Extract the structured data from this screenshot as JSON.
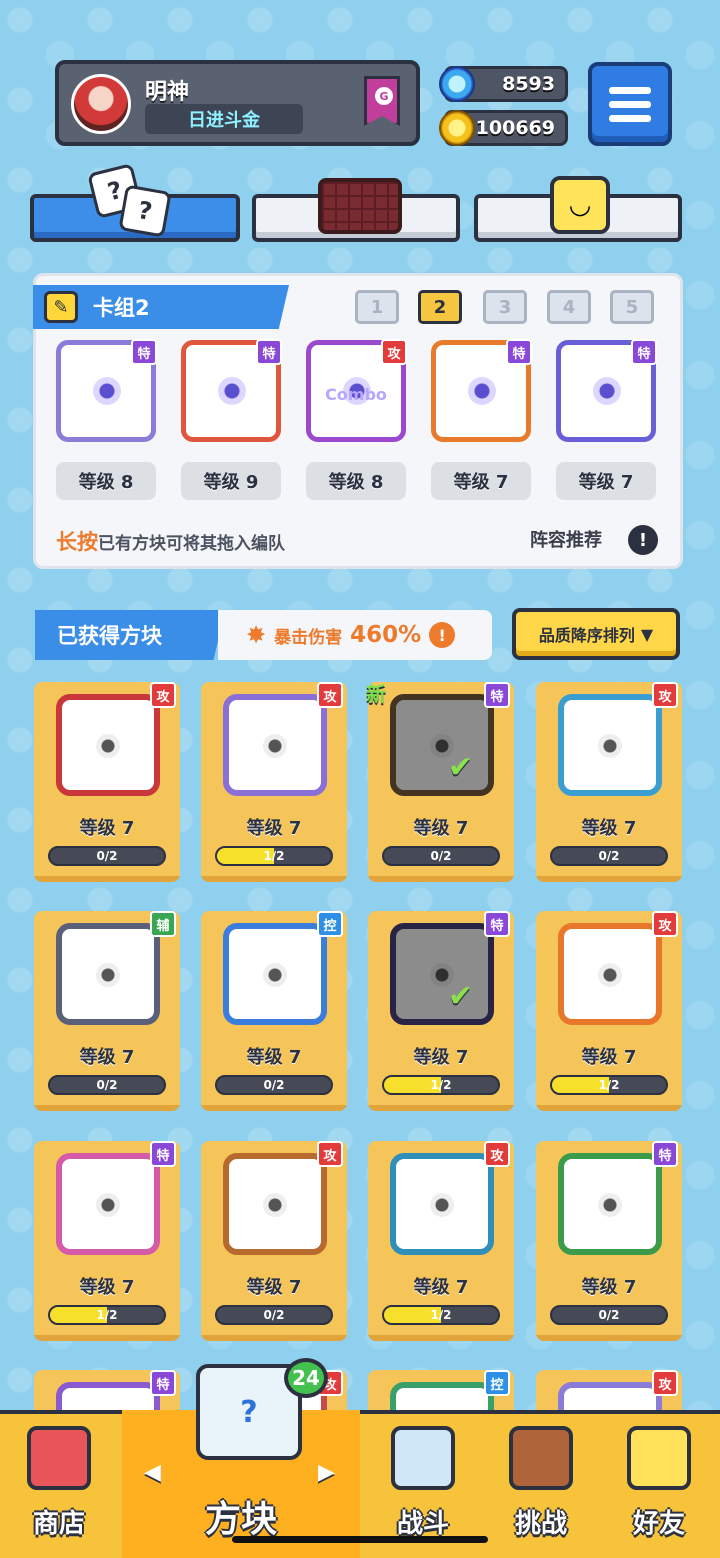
{
  "profile": {
    "name": "明神",
    "subtitle": "日进斗金",
    "rank_letter": "G"
  },
  "currency": {
    "gems": "8593",
    "coins": "100669"
  },
  "deck": {
    "title": "卡组2",
    "numbers": [
      "1",
      "2",
      "3",
      "4",
      "5"
    ],
    "selected_index": 1,
    "cards": [
      {
        "tag": "特",
        "level": "等级 8",
        "color": "#8a7cd8"
      },
      {
        "tag": "特",
        "level": "等级 9",
        "color": "#e0563c"
      },
      {
        "tag": "攻",
        "level": "等级 8",
        "color": "#9b4ad0",
        "label": "Combo"
      },
      {
        "tag": "特",
        "level": "等级 7",
        "color": "#e97a2b"
      },
      {
        "tag": "特",
        "level": "等级 7",
        "color": "#6a5fd8"
      }
    ],
    "hint_strong": "长按",
    "hint_rest": "已有方块可将其拖入编队",
    "recommend": "阵容推荐"
  },
  "owned": {
    "title": "已获得方块",
    "crit_label": "暴击伤害",
    "crit_value": "460%",
    "sort_label": "品质降序排列",
    "new_label": "新",
    "cards": [
      {
        "tag": "攻",
        "level": "等级 7",
        "progress": "0/2",
        "fill": 0,
        "color": "#c9373a"
      },
      {
        "tag": "攻",
        "level": "等级 7",
        "progress": "1/2",
        "fill": 0.5,
        "color": "#8a6fd6"
      },
      {
        "tag": "特",
        "level": "等级 7",
        "progress": "0/2",
        "fill": 0,
        "color": "#7a5c3a",
        "checked": true
      },
      {
        "tag": "攻",
        "level": "等级 7",
        "progress": "0/2",
        "fill": 0,
        "color": "#3a9ed0"
      },
      {
        "tag": "辅",
        "level": "等级 7",
        "progress": "0/2",
        "fill": 0,
        "color": "#5a5f7a"
      },
      {
        "tag": "控",
        "level": "等级 7",
        "progress": "0/2",
        "fill": 0,
        "color": "#3b7ddc"
      },
      {
        "tag": "特",
        "level": "等级 7",
        "progress": "1/2",
        "fill": 0.5,
        "color": "#4a3f80",
        "checked": true
      },
      {
        "tag": "攻",
        "level": "等级 7",
        "progress": "1/2",
        "fill": 0.5,
        "color": "#e9772b"
      },
      {
        "tag": "特",
        "level": "等级 7",
        "progress": "1/2",
        "fill": 0.5,
        "color": "#d55aa8"
      },
      {
        "tag": "攻",
        "level": "等级 7",
        "progress": "0/2",
        "fill": 0,
        "color": "#b86a2e"
      },
      {
        "tag": "攻",
        "level": "等级 7",
        "progress": "1/2",
        "fill": 0.5,
        "color": "#2f8fb8"
      },
      {
        "tag": "特",
        "level": "等级 7",
        "progress": "0/2",
        "fill": 0,
        "color": "#3c9b4a"
      },
      {
        "tag": "特",
        "color": "#8a5ad0"
      },
      {
        "tag": "攻",
        "color": "#c74a4a"
      },
      {
        "tag": "控",
        "color": "#3aa06a"
      },
      {
        "tag": "攻",
        "color": "#8a7cd8"
      }
    ]
  },
  "nav": {
    "shop": "商店",
    "blocks": "方块",
    "battle": "战斗",
    "challenge": "挑战",
    "friends": "好友",
    "blocks_count": "24"
  }
}
